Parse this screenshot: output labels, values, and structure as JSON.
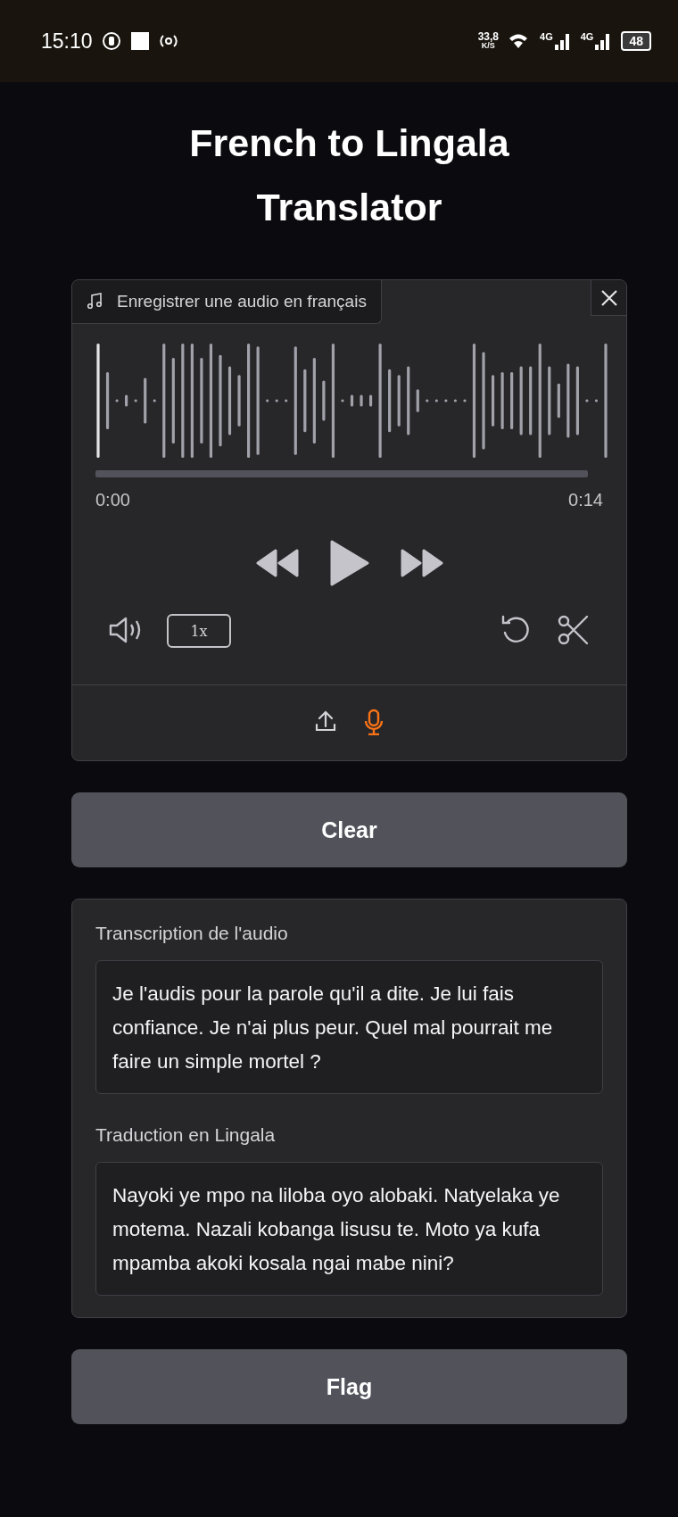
{
  "status_bar": {
    "time": "15:10",
    "net_speed": "33,8",
    "net_unit": "K/S",
    "signal_1": "4G",
    "signal_2": "4G",
    "battery": "48"
  },
  "title": "French to Lingala Translator",
  "audio_input": {
    "label": "Enregistrer une audio en français",
    "time_start": "0:00",
    "time_end": "0:14",
    "speed": "1x",
    "sources": [
      {
        "kind": "upload",
        "selected": false
      },
      {
        "kind": "microphone",
        "selected": true
      }
    ]
  },
  "clear_button": "Clear",
  "outputs": [
    {
      "label": "Transcription de l'audio",
      "value": "Je l'audis pour la parole qu'il a dite. Je lui fais confiance. Je n'ai plus peur. Quel mal pourrait me faire un simple mortel ?"
    },
    {
      "label": "Traduction en Lingala",
      "value": "Nayoki ye mpo na liloba oyo alobaki. Natyelaka ye motema. Nazali kobanga lisusu te. Moto ya kufa mpamba akoki kosala ngai mabe nini?"
    }
  ],
  "flag_button": "Flag"
}
